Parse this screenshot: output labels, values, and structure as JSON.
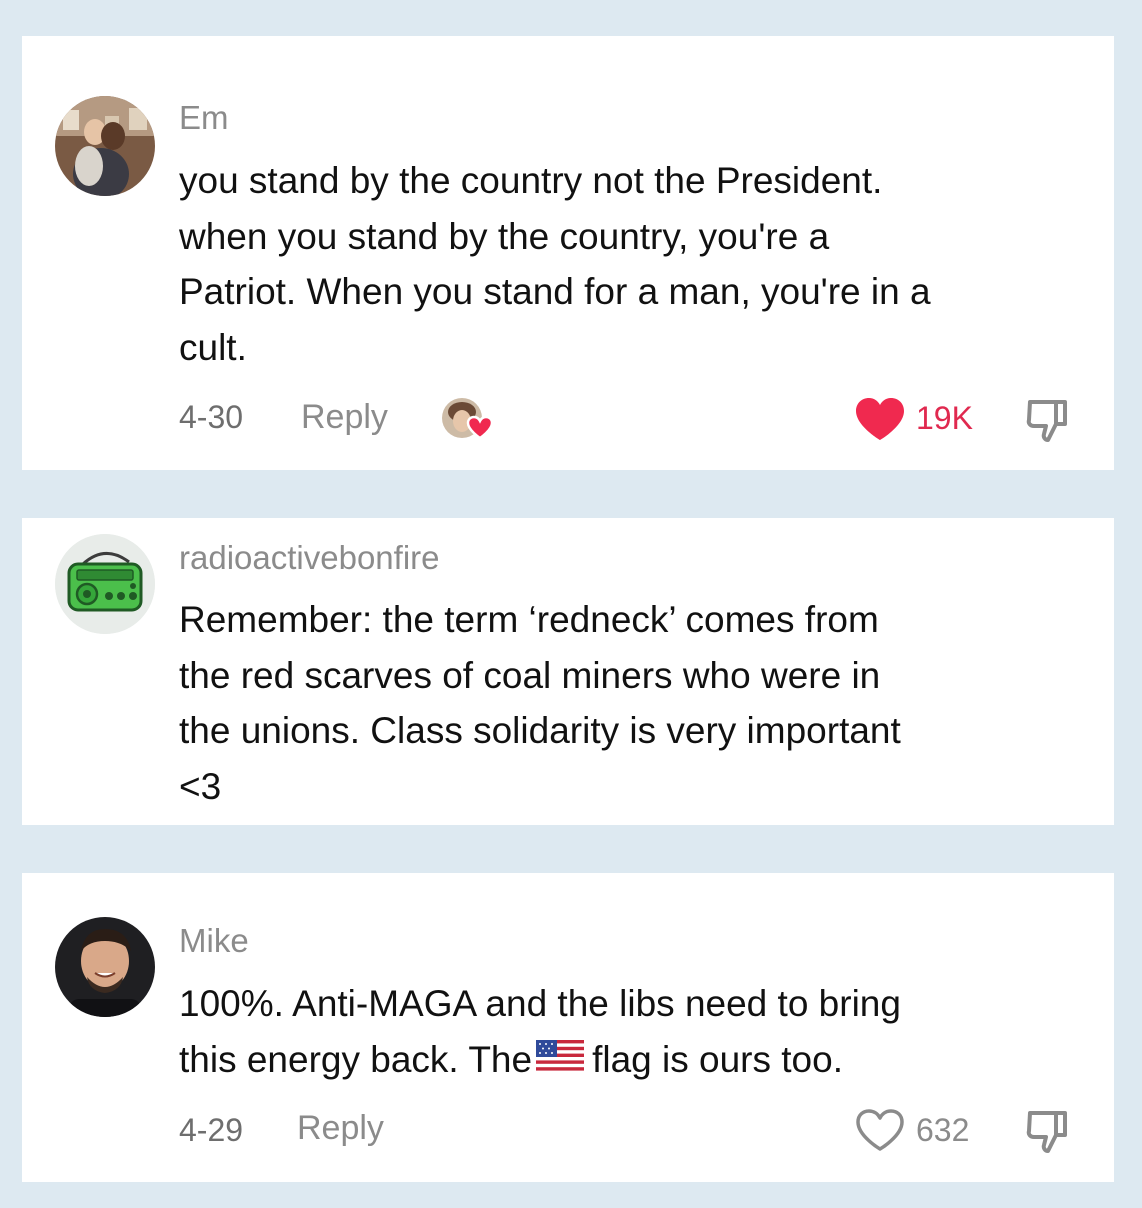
{
  "colors": {
    "background": "#dde9f1",
    "card": "#ffffff",
    "username": "#8b8b8b",
    "text": "#111111",
    "like_active": "#f0294f",
    "icon_gray": "#8b8b8b"
  },
  "comments": [
    {
      "username": "Em",
      "lines": [
        "you stand by the country not the President.",
        "when you stand by the country, you're a",
        "Patriot. When you stand for a man, you're in a",
        "cult."
      ],
      "date": "4-30",
      "reply_label": "Reply",
      "liked_by_creator": true,
      "liked": true,
      "like_count": "19K",
      "avatar_icon": "user-photo-avatar-icon"
    },
    {
      "username": "radioactivebonfire",
      "lines": [
        "Remember: the term ‘redneck’ comes from",
        "the red scarves of coal miners who were in",
        "the unions. Class solidarity is very important",
        "<3"
      ],
      "avatar_icon": "green-radio-avatar-icon"
    },
    {
      "username": "Mike",
      "lines": [
        "100%. Anti-MAGA and the libs need to bring",
        "this energy back. The"
      ],
      "line2_after_flag": "flag is ours too.",
      "flag_icon": "us-flag-emoji-icon",
      "date": "4-29",
      "reply_label": "Reply",
      "liked": false,
      "like_count": "632",
      "avatar_icon": "user-photo-avatar-icon"
    }
  ]
}
